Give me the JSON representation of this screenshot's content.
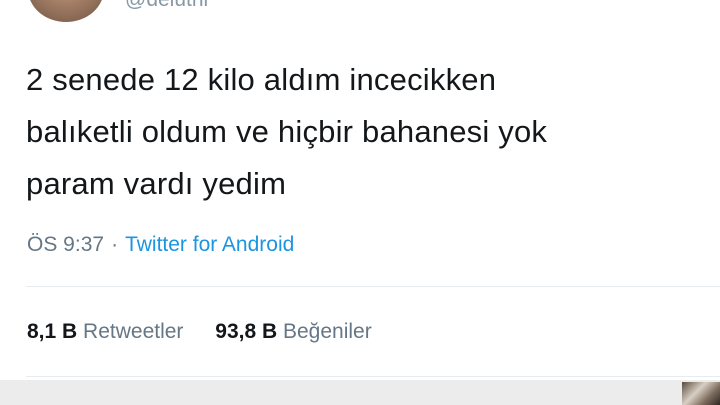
{
  "tweet": {
    "handle": "@deluthi",
    "text_lines": [
      "2 senede 12 kilo aldım incecikken",
      "balıketli oldum ve hiçbir bahanesi yok",
      "param vardı yedim"
    ],
    "time": "ÖS 9:37",
    "separator": "·",
    "source": "Twitter for Android",
    "stats": {
      "retweets_count": "8,1 B",
      "retweets_label": "Retweetler",
      "likes_count": "93,8 B",
      "likes_label": "Beğeniler"
    }
  },
  "colors": {
    "text": "#14171a",
    "muted": "#657786",
    "link": "#1b95e0",
    "divider": "#e6ecf0"
  }
}
